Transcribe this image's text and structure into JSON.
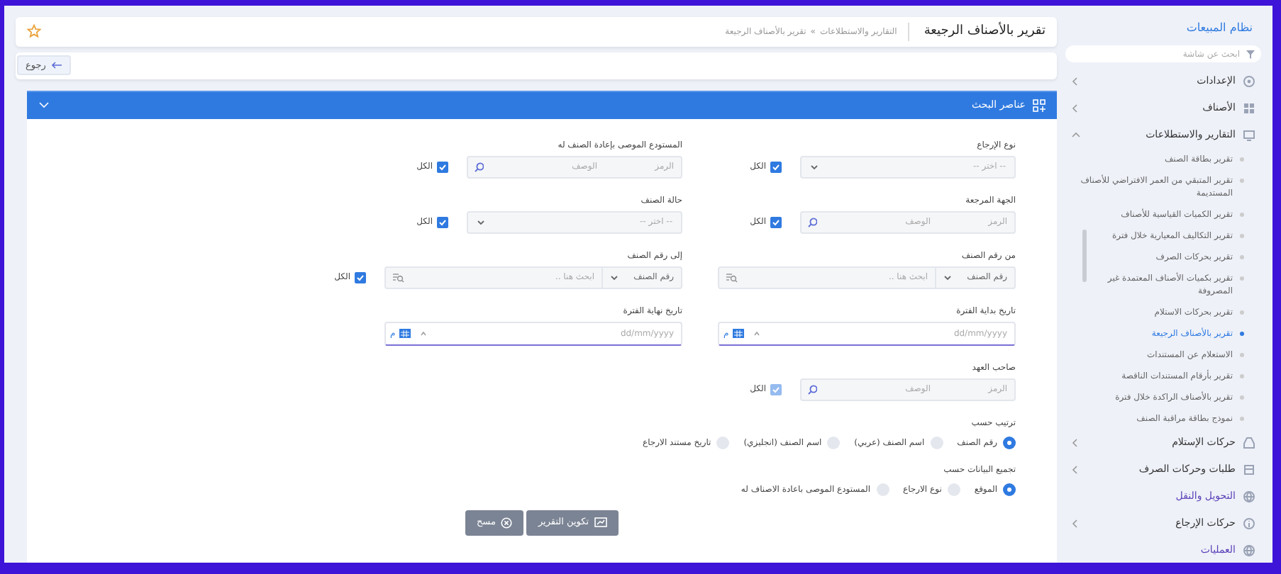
{
  "sidebar": {
    "title": "نظام المبيعات",
    "search": {
      "placeholder": "ابحث عن شاشة"
    },
    "items": [
      {
        "label": "الإعدادات",
        "kind": "group",
        "expanded": false
      },
      {
        "label": "الأصناف",
        "kind": "group",
        "expanded": false
      },
      {
        "label": "التقارير والاستطلاعات",
        "kind": "group",
        "expanded": true,
        "children": [
          {
            "label": "تقرير بطاقة الصنف",
            "selected": false
          },
          {
            "label": "تقرير المتبقي من العمر الافتراضي للأصناف المستديمة",
            "selected": false
          },
          {
            "label": "تقرير الكميات القياسية للأصناف",
            "selected": false
          },
          {
            "label": "تقرير التكاليف المعيارية خلال فترة",
            "selected": false
          },
          {
            "label": "تقرير بحركات الصرف",
            "selected": false
          },
          {
            "label": "تقرير بكميات الأصناف المعتمدة غير المصروفة",
            "selected": false
          },
          {
            "label": "تقرير بحركات الاستلام",
            "selected": false
          },
          {
            "label": "تقرير بالأصناف الرجيعة",
            "selected": true
          },
          {
            "label": "الاستعلام عن المستندات",
            "selected": false
          },
          {
            "label": "تقرير بأرقام المستندات الناقصة",
            "selected": false
          },
          {
            "label": "تقرير بالأصناف الراكدة خلال فترة",
            "selected": false
          },
          {
            "label": "نموذج بطاقة مراقبة الصنف",
            "selected": false
          }
        ]
      },
      {
        "label": "حركات الإستلام",
        "kind": "group",
        "expanded": false
      },
      {
        "label": "طلبات وحركات الصرف",
        "kind": "group",
        "expanded": false
      },
      {
        "label": "التحويل والنقل",
        "kind": "link"
      },
      {
        "label": "حركات الإرجاع",
        "kind": "group",
        "expanded": false
      },
      {
        "label": "العمليات",
        "kind": "link"
      }
    ]
  },
  "header": {
    "title": "تقرير بالأصناف الرجيعة",
    "breadcrumb": [
      "التقارير والاستطلاعات",
      "تقرير بالأصناف الرجيعة"
    ],
    "breadcrumb_separator": "»"
  },
  "toolbar": {
    "back_button": "رجوع"
  },
  "panel": {
    "title": "عناصر البحث",
    "expanded": true,
    "rows": [
      [
        {
          "kind": "select",
          "label": "نوع الإرجاع",
          "placeholder": "-- اختر --",
          "all_label": "الكل",
          "all_checked": true,
          "all_disabled": false
        },
        {
          "kind": "lookup",
          "label": "المستودع الموصى بإعادة الصنف له",
          "code_placeholder": "الرمز",
          "desc_placeholder": "الوصف",
          "all_label": "الكل",
          "all_checked": true,
          "all_disabled": false
        }
      ],
      [
        {
          "kind": "lookup",
          "label": "الجهة المرجعة",
          "code_placeholder": "الرمز",
          "desc_placeholder": "الوصف",
          "all_label": "الكل",
          "all_checked": true,
          "all_disabled": false
        },
        {
          "kind": "select",
          "label": "حالة الصنف",
          "placeholder": "-- اختر --",
          "all_label": "الكل",
          "all_checked": true,
          "all_disabled": false
        }
      ],
      [
        {
          "kind": "item_search",
          "label": "من رقم الصنف",
          "select_value": "رقم الصنف",
          "placeholder": "ابحث هنا .."
        },
        {
          "kind": "item_search",
          "label": "إلى رقم الصنف",
          "select_value": "رقم الصنف",
          "placeholder": "ابحث هنا ..",
          "all_label": "الكل",
          "all_checked": true,
          "all_disabled": false
        }
      ],
      [
        {
          "kind": "date",
          "label": "تاريخ بداية الفترة",
          "placeholder": "dd/mm/yyyy",
          "calendar_label": "م"
        },
        {
          "kind": "date",
          "label": "تاريخ نهاية الفترة",
          "placeholder": "dd/mm/yyyy",
          "calendar_label": "م"
        }
      ],
      [
        {
          "kind": "lookup",
          "label": "صاحب العهد",
          "code_placeholder": "الرمز",
          "desc_placeholder": "الوصف",
          "all_label": "الكل",
          "all_checked": true,
          "all_disabled": true
        }
      ]
    ],
    "radio_groups": [
      {
        "label": "ترتيب حسب",
        "options": [
          {
            "label": "رقم الصنف",
            "selected": true
          },
          {
            "label": "اسم الصنف (عربي)",
            "selected": false
          },
          {
            "label": "اسم الصنف (انجليزي)",
            "selected": false
          },
          {
            "label": "تاريخ مستند الارجاع",
            "selected": false
          }
        ]
      },
      {
        "label": "تجميع البيانات حسب",
        "options": [
          {
            "label": "الموقع",
            "selected": true
          },
          {
            "label": "نوع الارجاع",
            "selected": false
          },
          {
            "label": "المستودع الموصى باعادة الاصناف له",
            "selected": false
          }
        ]
      }
    ],
    "buttons": [
      {
        "kind": "generate",
        "label": "تكوين التقرير"
      },
      {
        "kind": "clear",
        "label": "مسح"
      }
    ]
  }
}
